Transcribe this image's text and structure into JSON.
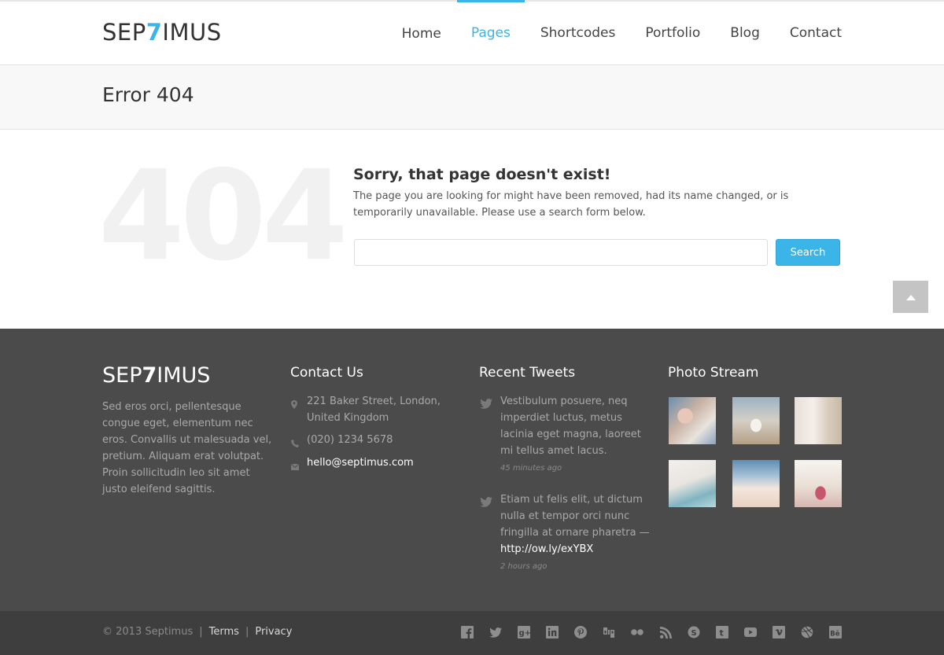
{
  "header": {
    "logo": {
      "prefix": "SEP",
      "seven": "7",
      "suffix": "IMUS"
    },
    "nav": [
      {
        "label": "Home"
      },
      {
        "label": "Pages"
      },
      {
        "label": "Shortcodes"
      },
      {
        "label": "Portfolio"
      },
      {
        "label": "Blog"
      },
      {
        "label": "Contact"
      }
    ],
    "active_nav": "Pages",
    "accent_color": "#3bb5e8"
  },
  "page": {
    "title": "Error 404"
  },
  "error": {
    "big_number": "404",
    "heading": "Sorry, that page doesn't exist!",
    "text": "The page you are looking for might have been removed, had its name changed, or is temporarily unavailable. Please use a search form below.",
    "search_value": "",
    "search_button": "Search"
  },
  "footer": {
    "logo": {
      "prefix": "SEP",
      "seven": "7",
      "suffix": "IMUS"
    },
    "about": "Sed eros orci, pellentesque congue eget, elementum nec eros. Convallis ut malesuada vel, pretium. Aliquam erat volutpat. Proin sollicitudin leo sit amet justo eleifend sagittis.",
    "contact": {
      "title": "Contact Us",
      "address": "221 Baker Street, London, United Kingdom",
      "phone": "(020) 1234 5678",
      "email": "hello@septimus.com"
    },
    "tweets": {
      "title": "Recent Tweets",
      "items": [
        {
          "text": "Vestibulum posuere, neq imperdiet luctus, metus lacinia eget magna, laoreet mi tellus amet lacus.",
          "link": "",
          "time": "45 minutes ago"
        },
        {
          "text": "Etiam ut felis elit, ut dictum nulla et tempor orci nunc fringilla at ornare pharetra —",
          "link": "http://ow.ly/exYBX",
          "time": "2 hours ago"
        }
      ]
    },
    "photos": {
      "title": "Photo Stream",
      "items": [
        "photo-knitting",
        "photo-bird",
        "photo-interior",
        "photo-bicycle",
        "photo-chair",
        "photo-bokeh"
      ]
    }
  },
  "bottombar": {
    "copyright": "© 2013 Septimus",
    "links": [
      "Terms",
      "Privacy"
    ],
    "socials": [
      "facebook-icon",
      "twitter-icon",
      "google-plus-icon",
      "linkedin-icon",
      "pinterest-icon",
      "digg-icon",
      "flickr-icon",
      "rss-icon",
      "skype-icon",
      "tumblr-icon",
      "youtube-icon",
      "vimeo-icon",
      "dribbble-icon",
      "behance-icon"
    ]
  }
}
